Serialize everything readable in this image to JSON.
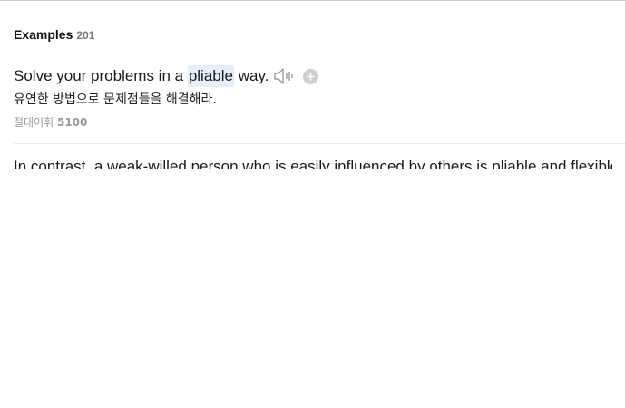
{
  "examples": {
    "title": "Examples",
    "count": "201"
  },
  "example_item": {
    "sentence_before": "Solve your problems in a ",
    "sentence_highlight": "pliable",
    "sentence_after": " way.",
    "translation": "유연한 방법으로 문제점들을 해결해라.",
    "source_name": "절대어휘",
    "source_number": "5100",
    "icons": {
      "speaker": "speaker-icon",
      "add": "plus-icon"
    },
    "highlight_color": "#e5eefb"
  },
  "next_example": {
    "sentence": "In contrast, a weak-willed person who is easily influenced by others is pliable and flexible."
  }
}
